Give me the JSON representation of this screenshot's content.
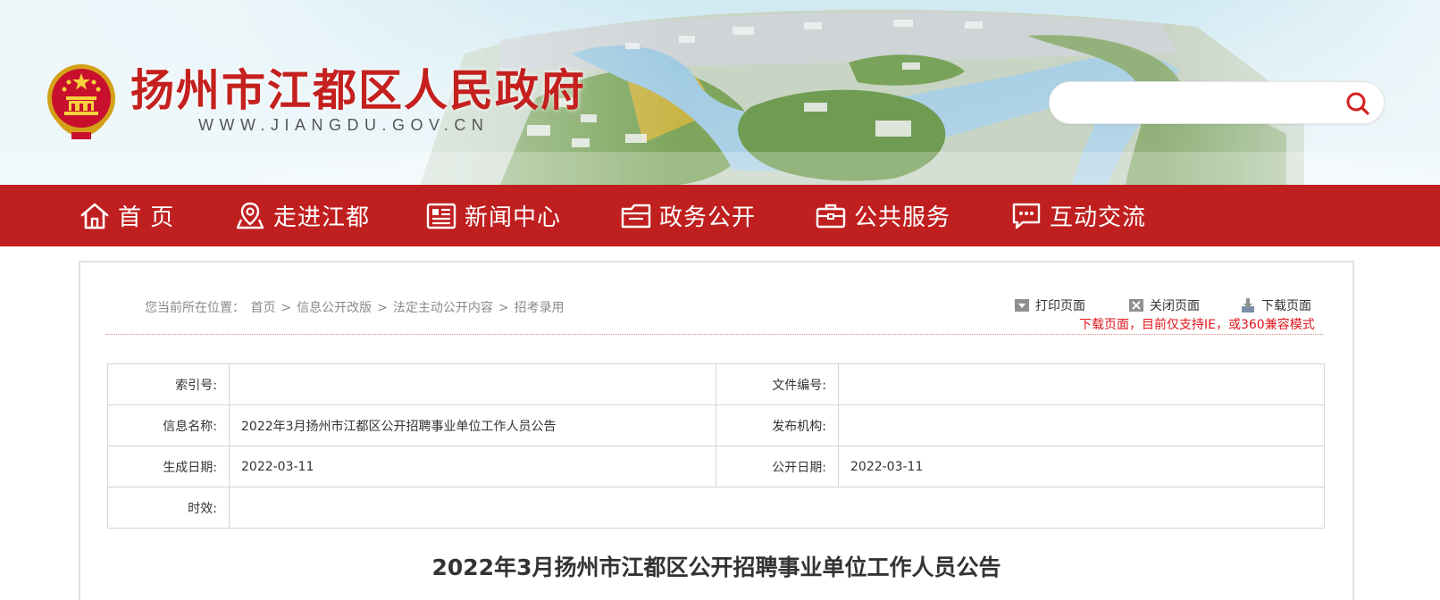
{
  "header": {
    "site_title": "扬州市江都区人民政府",
    "site_url": "WWW.JIANGDU.GOV.CN",
    "search": {
      "placeholder": "",
      "value": ""
    },
    "colors": {
      "title_red": "#c4201e"
    }
  },
  "nav": {
    "background": "#c01f1f",
    "items": [
      {
        "label": "首 页",
        "icon": "home-icon"
      },
      {
        "label": "走进江都",
        "icon": "map-pin-icon"
      },
      {
        "label": "新闻中心",
        "icon": "newspaper-icon"
      },
      {
        "label": "政务公开",
        "icon": "folder-icon"
      },
      {
        "label": "公共服务",
        "icon": "briefcase-icon"
      },
      {
        "label": "互动交流",
        "icon": "chat-icon"
      }
    ]
  },
  "breadcrumb": {
    "prefix": "您当前所在位置：",
    "items": [
      "首页",
      "信息公开改版",
      "法定主动公开内容",
      "招考录用"
    ],
    "separator": ">"
  },
  "tools": {
    "print": "打印页面",
    "close": "关闭页面",
    "download": "下载页面",
    "notice": "下载页面，目前仅支持IE，或360兼容模式"
  },
  "meta": {
    "index_label": "索引号:",
    "index_value": "",
    "doc_no_label": "文件编号:",
    "doc_no_value": "",
    "name_label": "信息名称:",
    "name_value": "2022年3月扬州市江都区公开招聘事业单位工作人员公告",
    "publisher_label": "发布机构:",
    "publisher_value": "",
    "created_label": "生成日期:",
    "created_value": "2022-03-11",
    "public_label": "公开日期:",
    "public_value": "2022-03-11",
    "validity_label": "时效:",
    "validity_value": ""
  },
  "article": {
    "title": "2022年3月扬州市江都区公开招聘事业单位工作人员公告"
  }
}
